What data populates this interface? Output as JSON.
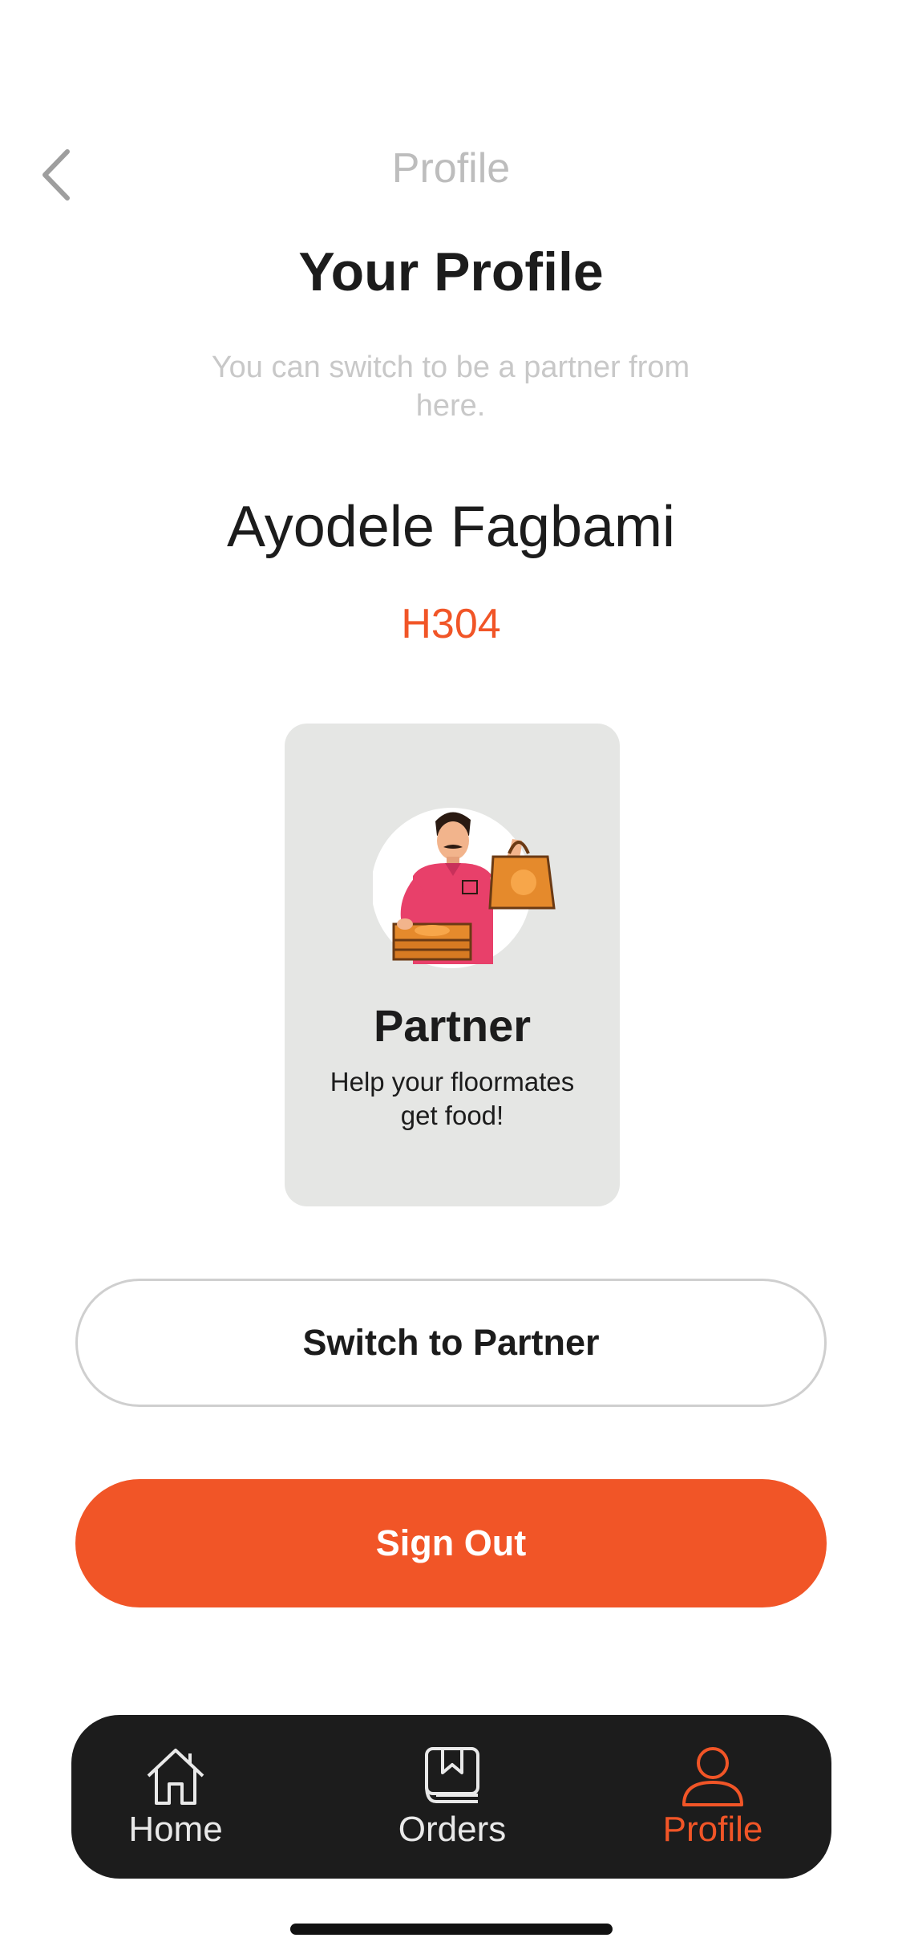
{
  "header": {
    "title": "Profile",
    "back_icon": "chevron-left-icon"
  },
  "page": {
    "heading": "Your Profile",
    "subtitle": "You can switch to be a partner from here."
  },
  "user": {
    "name": "Ayodele Fagbami",
    "room": "H304"
  },
  "partner_card": {
    "illustration": "delivery-person-illustration",
    "title": "Partner",
    "description": "Help your floormates get food!"
  },
  "actions": {
    "switch_label": "Switch to Partner",
    "signout_label": "Sign Out"
  },
  "tabbar": {
    "items": [
      {
        "label": "Home",
        "icon": "home-icon",
        "active": false
      },
      {
        "label": "Orders",
        "icon": "orders-icon",
        "active": false
      },
      {
        "label": "Profile",
        "icon": "profile-icon",
        "active": true
      }
    ]
  },
  "colors": {
    "accent": "#f15527",
    "tabbar_bg": "#1c1c1c",
    "card_bg": "#e5e6e4"
  }
}
